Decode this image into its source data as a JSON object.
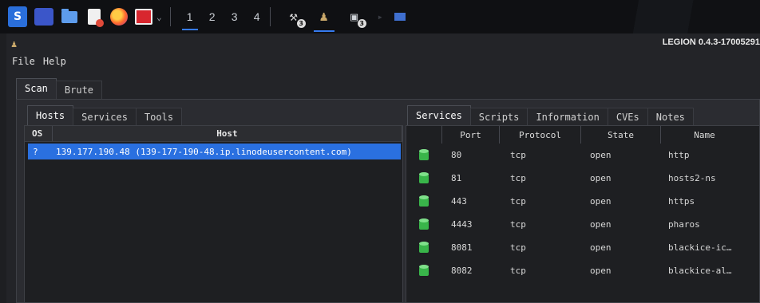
{
  "taskbar": {
    "workspaces": [
      "1",
      "2",
      "3",
      "4"
    ],
    "active_workspace": "1",
    "app_badges": [
      "3",
      "3"
    ],
    "accent": "#367bf0"
  },
  "window": {
    "title": "LEGION 0.4.3-17005291",
    "menu": [
      "File",
      "Help"
    ]
  },
  "outer_tabs": [
    "Scan",
    "Brute"
  ],
  "left_tabs": [
    "Hosts",
    "Services",
    "Tools"
  ],
  "hosts_table": {
    "columns": [
      "OS",
      "Host"
    ],
    "rows": [
      {
        "os": "?",
        "host": "139.177.190.48 (139-177-190-48.ip.linodeusercontent.com)"
      }
    ],
    "selected_color": "#2a70e0"
  },
  "right_tabs": [
    "Services",
    "Scripts",
    "Information",
    "CVEs",
    "Notes"
  ],
  "services_table": {
    "columns": [
      "Port",
      "Protocol",
      "State",
      "Name"
    ],
    "rows": [
      {
        "port": "80",
        "protocol": "tcp",
        "state": "open",
        "name": "http"
      },
      {
        "port": "81",
        "protocol": "tcp",
        "state": "open",
        "name": "hosts2-ns"
      },
      {
        "port": "443",
        "protocol": "tcp",
        "state": "open",
        "name": "https"
      },
      {
        "port": "4443",
        "protocol": "tcp",
        "state": "open",
        "name": "pharos"
      },
      {
        "port": "8081",
        "protocol": "tcp",
        "state": "open",
        "name": "blackice-ic…"
      },
      {
        "port": "8082",
        "protocol": "tcp",
        "state": "open",
        "name": "blackice-al…"
      }
    ],
    "status_icon_color": "#39b54a"
  }
}
